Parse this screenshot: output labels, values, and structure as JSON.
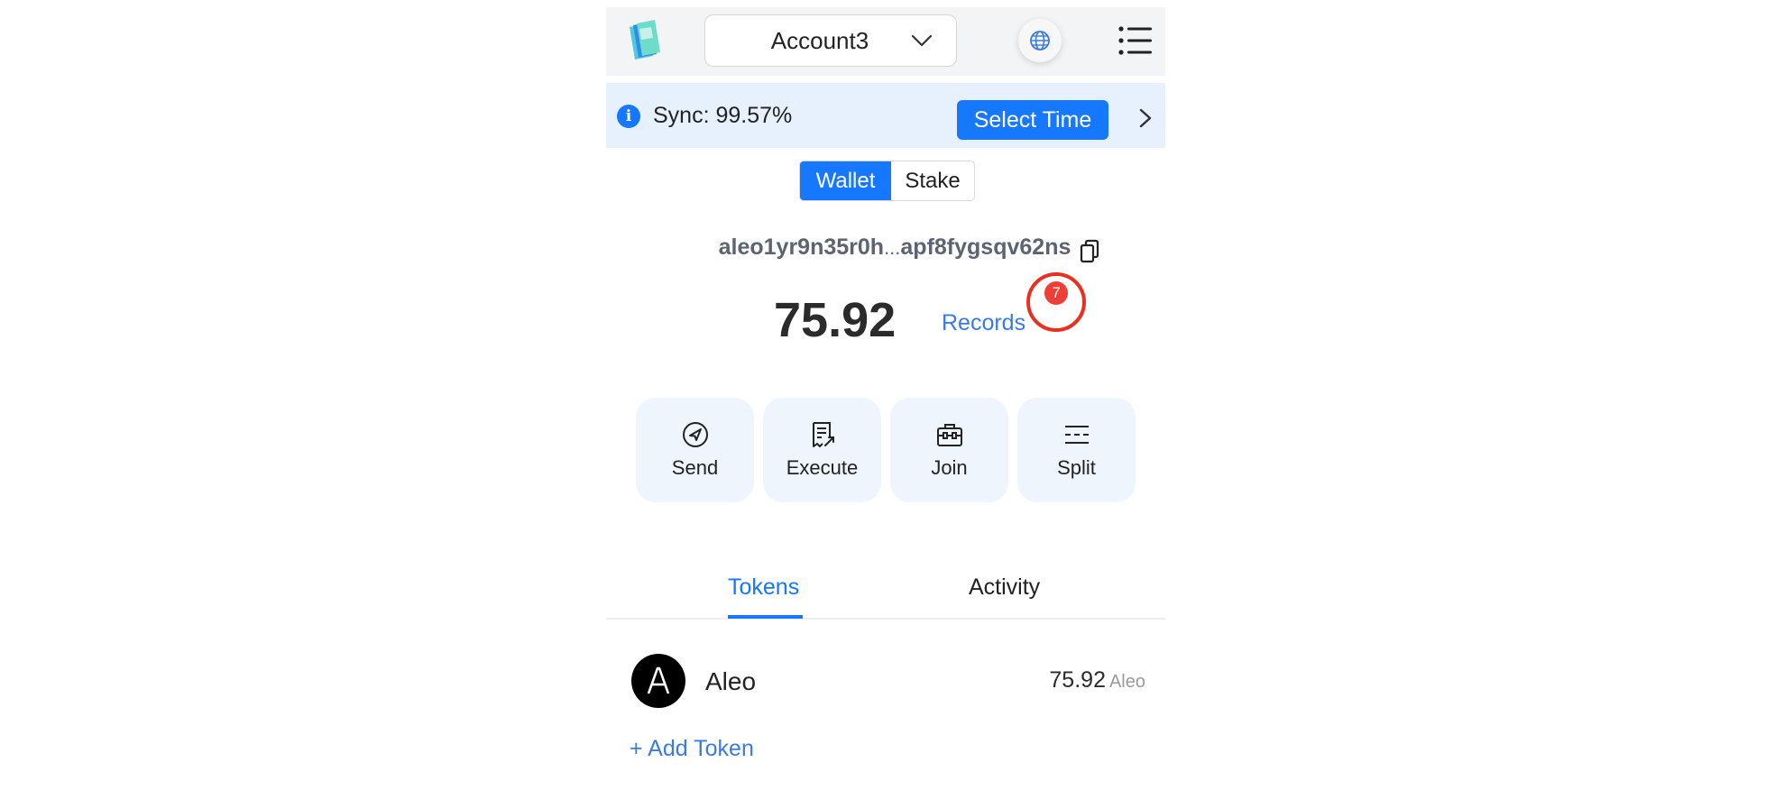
{
  "header": {
    "account_name": "Account3"
  },
  "sync": {
    "text": "Sync: 99.57%",
    "progress_percent": 99.57,
    "select_time_label": "Select Time"
  },
  "mode_switch": {
    "wallet_label": "Wallet",
    "stake_label": "Stake",
    "selected": "Wallet"
  },
  "wallet": {
    "address_start": "aleo1yr9n35r0h",
    "address_ellipsis": "...",
    "address_end": "apf8fygsqv62ns",
    "balance": "75.92",
    "records_label": "Records",
    "records_count": "7"
  },
  "actions": [
    {
      "label": "Send",
      "icon": "send-icon"
    },
    {
      "label": "Execute",
      "icon": "execute-icon"
    },
    {
      "label": "Join",
      "icon": "join-icon"
    },
    {
      "label": "Split",
      "icon": "split-icon"
    }
  ],
  "tabs": {
    "tokens_label": "Tokens",
    "activity_label": "Activity",
    "active": "Tokens"
  },
  "tokens": [
    {
      "name": "Aleo",
      "amount": "75.92",
      "unit": "Aleo",
      "icon": "aleo-logo"
    }
  ],
  "add_token_label": "+ Add Token",
  "colors": {
    "accent": "#1677ff",
    "link": "#3b7be0",
    "badge": "#ef3e36",
    "highlight": "#e8301f",
    "sync_bg": "#e6f1fd",
    "action_bg": "#eef5fc"
  }
}
